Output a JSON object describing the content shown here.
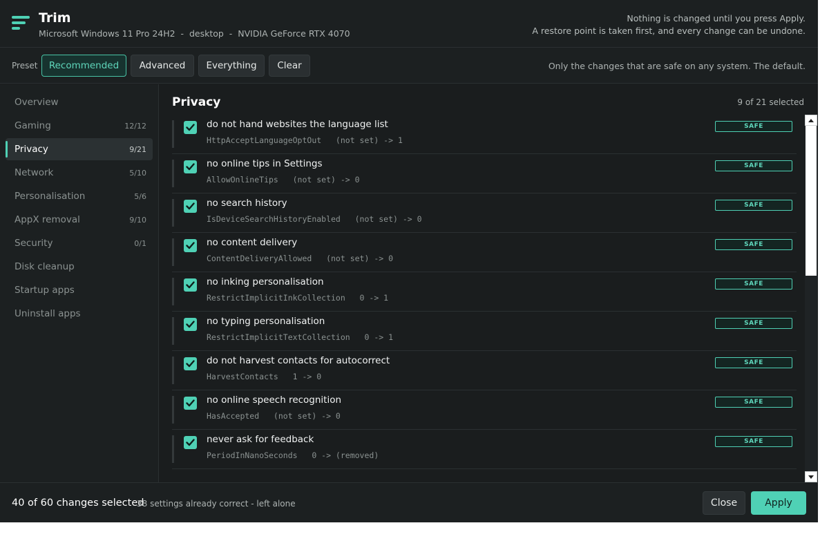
{
  "app": {
    "title": "Trim",
    "sysinfo": "Microsoft Windows 11 Pro 24H2  -  desktop  -  NVIDIA GeForce RTX 4070",
    "notice_line1": "Nothing is changed until you press Apply.",
    "notice_line2": "A restore point is taken first, and every change can be undone.",
    "logo_icon": "hamburger-logo-icon",
    "accent_color": "#4fd1b5"
  },
  "preset": {
    "label": "Preset",
    "buttons": [
      "Recommended",
      "Advanced",
      "Everything",
      "Clear"
    ],
    "selected": "Recommended",
    "description": "Only the changes that are safe on any system. The default."
  },
  "sidebar": {
    "items": [
      {
        "label": "Overview",
        "count": ""
      },
      {
        "label": "Gaming",
        "count": "12/12"
      },
      {
        "label": "Privacy",
        "count": "9/21"
      },
      {
        "label": "Network",
        "count": "5/10"
      },
      {
        "label": "Personalisation",
        "count": "5/6"
      },
      {
        "label": "AppX removal",
        "count": "9/10"
      },
      {
        "label": "Security",
        "count": "0/1"
      },
      {
        "label": "Disk cleanup",
        "count": ""
      },
      {
        "label": "Startup apps",
        "count": ""
      },
      {
        "label": "Uninstall apps",
        "count": ""
      }
    ],
    "active": "Privacy"
  },
  "main": {
    "title": "Privacy",
    "count": "9 of 21 selected",
    "rows": [
      {
        "title": "do not hand websites the language list",
        "key": "HttpAcceptLanguageOptOut   (not set) -> 1",
        "badge": "SAFE",
        "checked": true
      },
      {
        "title": "no online tips in Settings",
        "key": "AllowOnlineTips   (not set) -> 0",
        "badge": "SAFE",
        "checked": true
      },
      {
        "title": "no search history",
        "key": "IsDeviceSearchHistoryEnabled   (not set) -> 0",
        "badge": "SAFE",
        "checked": true
      },
      {
        "title": "no content delivery",
        "key": "ContentDeliveryAllowed   (not set) -> 0",
        "badge": "SAFE",
        "checked": true
      },
      {
        "title": "no inking personalisation",
        "key": "RestrictImplicitInkCollection   0 -> 1",
        "badge": "SAFE",
        "checked": true
      },
      {
        "title": "no typing personalisation",
        "key": "RestrictImplicitTextCollection   0 -> 1",
        "badge": "SAFE",
        "checked": true
      },
      {
        "title": "do not harvest contacts for autocorrect",
        "key": "HarvestContacts   1 -> 0",
        "badge": "SAFE",
        "checked": true
      },
      {
        "title": "no online speech recognition",
        "key": "HasAccepted   (not set) -> 0",
        "badge": "SAFE",
        "checked": true
      },
      {
        "title": "never ask for feedback",
        "key": "PeriodInNanoSeconds   0 -> (removed)",
        "badge": "SAFE",
        "checked": true
      }
    ]
  },
  "footer": {
    "summary": "40 of 60 changes selected",
    "detail": "38 settings already correct - left alone",
    "close_label": "Close",
    "apply_label": "Apply"
  }
}
